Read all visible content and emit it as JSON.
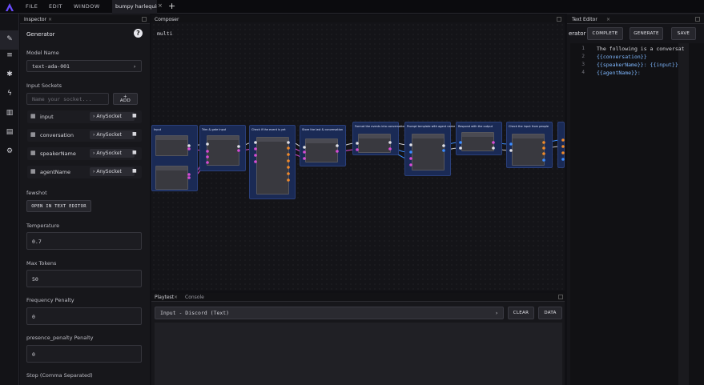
{
  "menu": {
    "file": "FILE",
    "edit": "EDIT",
    "window": "WINDOW"
  },
  "tabs": {
    "active": "bumpy harlequin",
    "add": "+"
  },
  "inspector": {
    "tab": "Inspector",
    "title": "Generator",
    "model_label": "Model Name",
    "model_value": "text-ada-001",
    "input_sockets_label": "Input Sockets",
    "socket_placeholder": "Name your socket...",
    "add_button": "ADD",
    "sockets": [
      {
        "name": "input",
        "type": "AnySocket"
      },
      {
        "name": "conversation",
        "type": "AnySocket"
      },
      {
        "name": "speakerName",
        "type": "AnySocket"
      },
      {
        "name": "agentName",
        "type": "AnySocket"
      }
    ],
    "fewshot_label": "fewshot",
    "open_text_editor": "OPEN IN TEXT EDITOR",
    "temperature_label": "Temperature",
    "temperature_value": "0.7",
    "max_tokens_label": "Max Tokens",
    "max_tokens_value": "50",
    "frequency_label": "Frequency Penalty",
    "frequency_value": "0",
    "presence_label": "presence_penalty Penalty",
    "presence_value": "0",
    "stop_label": "Stop (Comma Separated)"
  },
  "composer": {
    "tab": "Composer",
    "title": "multi"
  },
  "playtest": {
    "tab": "Playtest",
    "console_tab": "Console",
    "input_select": "Input - Discord (Text)",
    "clear": "CLEAR",
    "data": "DATA"
  },
  "text_editor": {
    "tab": "Text Editor",
    "title_fragment": "erator",
    "complete": "COMPLETE",
    "generate": "GENERATE",
    "save": "SAVE",
    "lines": [
      {
        "n": "1",
        "text": "The following is a conversat"
      },
      {
        "n": "2",
        "text": "{{conversation}}"
      },
      {
        "n": "3",
        "text": "{{speakerName}}: {{input}}"
      },
      {
        "n": "4",
        "text": "{{agentName}}:"
      }
    ]
  },
  "colors": {
    "accent": "#7c5cff",
    "group_fill": "#1a2a55",
    "socket_pink": "#d84bd4",
    "socket_orange": "#f08a2a",
    "socket_blue": "#3b8cff"
  }
}
